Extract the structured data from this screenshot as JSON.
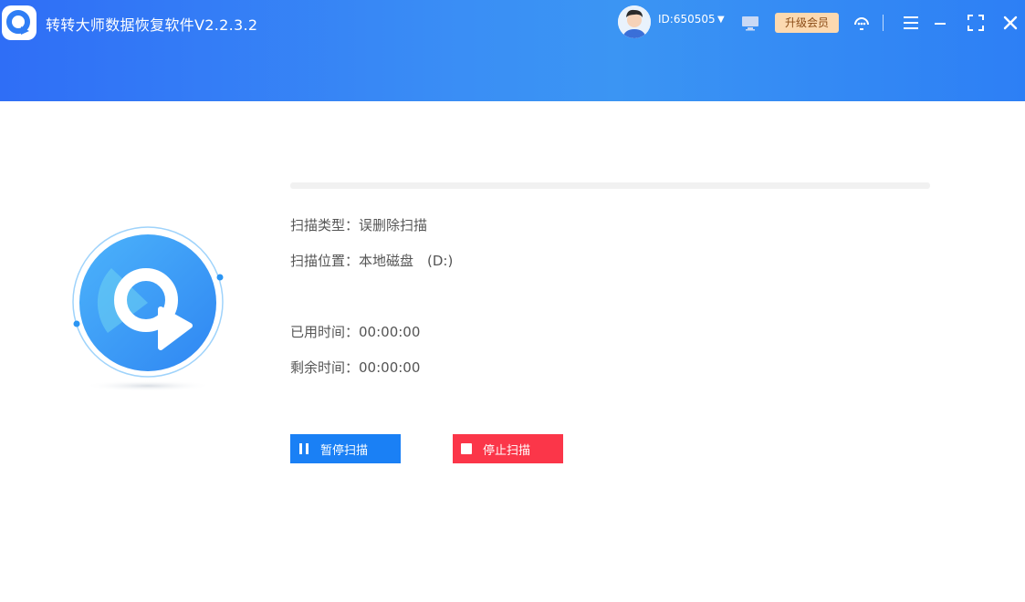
{
  "app": {
    "title": "转转大师数据恢复软件V2.2.3.2"
  },
  "header": {
    "user_id": "ID:650505",
    "vip_label": "升级会员"
  },
  "scan": {
    "progress": 0,
    "type_label": "扫描类型：",
    "type_value": "误删除扫描",
    "location_label": "扫描位置：",
    "location_value": "本地磁盘　(D:)",
    "elapsed_label": "已用时间：",
    "elapsed_value": "00:00:00",
    "remaining_label": "剩余时间：",
    "remaining_value": "00:00:00"
  },
  "actions": {
    "pause_label": "暂停扫描",
    "stop_label": "停止扫描"
  },
  "colors": {
    "header_blue": "#3a8ef5",
    "pause_blue": "#1a80f5",
    "stop_red": "#fb3649",
    "vip_bg": "#fcd9b0"
  },
  "icons": [
    "app-logo-icon",
    "avatar",
    "caret-down-icon",
    "monitor-icon",
    "support-icon",
    "menu-icon",
    "minimize-icon",
    "maximize-icon",
    "close-icon",
    "pause-icon",
    "stop-icon"
  ]
}
